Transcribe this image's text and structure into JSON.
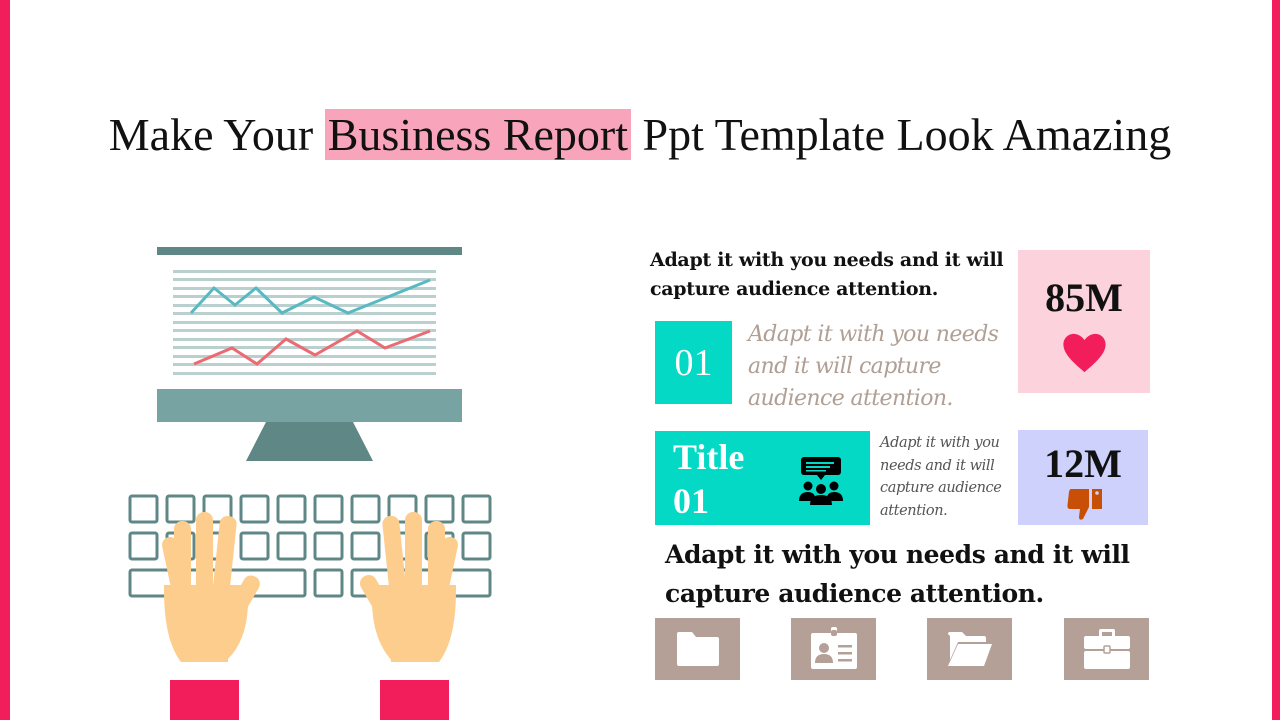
{
  "slide": {
    "title": {
      "before": "Make Your ",
      "highlight": "Business Report",
      "after": " Ppt Template Look Amazing"
    },
    "colors": {
      "accent_pink": "#f21d5b",
      "highlight_pink": "#f8a5bb",
      "teal": "#03d9c5",
      "card_pink": "#fcd2dc",
      "card_lavender": "#cdd1fb",
      "tile_taupe": "#b5a098",
      "monitor_dark": "#5f8785",
      "monitor_light": "#78a3a3",
      "chart_line_blue": "#58b9c3",
      "chart_line_red": "#ec6b72",
      "hand_skin": "#fdcd8e",
      "thumbs_down": "#c84f06"
    },
    "right_panel": {
      "heading_top": "Adapt it with you needs and it will capture audience attention.",
      "step_number": "01",
      "step_text": "Adapt it with you needs and it will capture audience attention.",
      "stat_likes": {
        "value": "85M",
        "icon": "heart-icon"
      },
      "title_box": {
        "line1": "Title",
        "line2": "01",
        "icon": "audience-chat-icon"
      },
      "title_box_text": "Adapt it with you needs and it will capture audience attention.",
      "stat_dislikes": {
        "value": "12M",
        "icon": "thumbs-down-icon"
      },
      "heading_bottom": "Adapt it with you needs and it will capture audience attention.",
      "icon_tiles": [
        "folder-icon",
        "id-badge-icon",
        "folder-open-icon",
        "briefcase-icon"
      ]
    },
    "illustration": {
      "subject": "monitor with line chart and hands typing on keyboard",
      "chart_lines": [
        "blue-line",
        "red-line"
      ]
    }
  }
}
